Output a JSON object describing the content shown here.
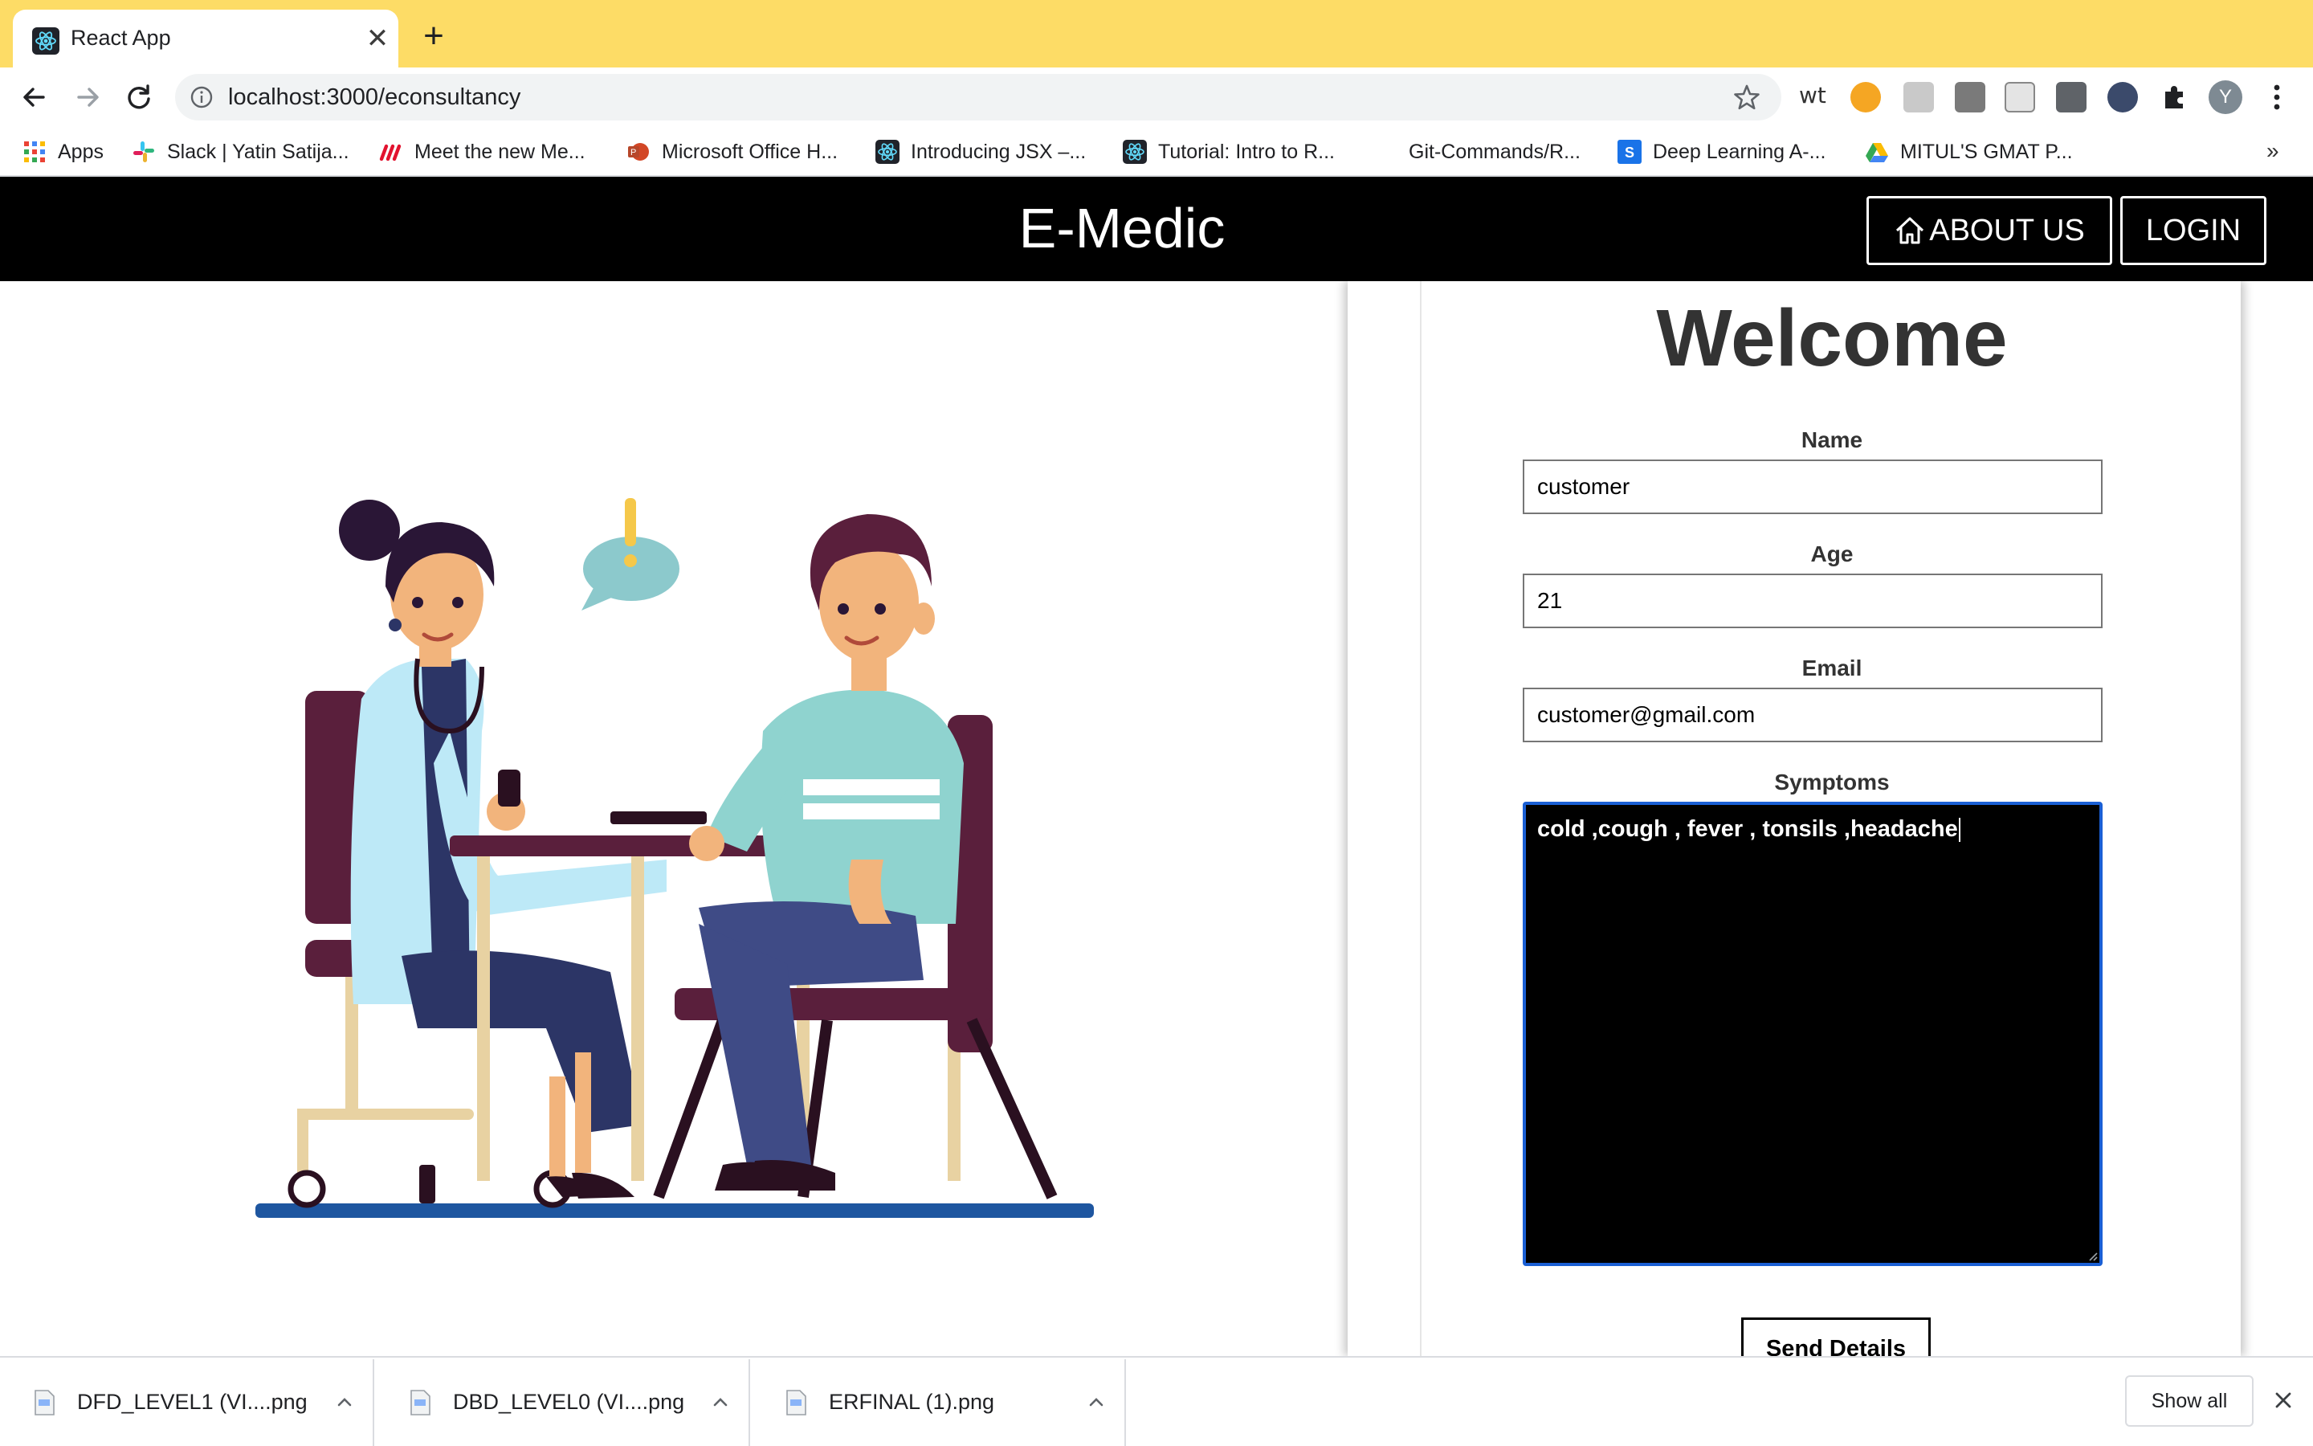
{
  "browser": {
    "tab_title": "React App",
    "new_tab_symbol": "+",
    "close_symbol": "✕",
    "url": "localhost:3000/econsultancy",
    "extension_wt": "wt",
    "profile_initial": "Y",
    "colors": {
      "tabstrip": "#fddc66",
      "omnibox": "#f1f3f4"
    }
  },
  "bookmarks": {
    "items": [
      {
        "label": "Apps",
        "icon": "apps-grid-icon"
      },
      {
        "label": "Slack | Yatin Satija...",
        "icon": "slack-icon"
      },
      {
        "label": "Meet the new Me...",
        "icon": "monday-icon"
      },
      {
        "label": "Microsoft Office H...",
        "icon": "office-icon"
      },
      {
        "label": "Introducing JSX –...",
        "icon": "react-icon"
      },
      {
        "label": "Tutorial: Intro to R...",
        "icon": "react-icon"
      },
      {
        "label": "Git-Commands/R...",
        "icon": "none"
      },
      {
        "label": "Deep Learning A-...",
        "icon": "s-icon"
      },
      {
        "label": "MITUL'S GMAT P...",
        "icon": "drive-icon"
      }
    ],
    "more_symbol": "»"
  },
  "app": {
    "brand": "E-Medic",
    "about_button": "ABOUT US",
    "login_button": "LOGIN",
    "header_color": "#000000"
  },
  "form": {
    "welcome": "Welcome",
    "name_label": "Name",
    "name_value": "customer",
    "age_label": "Age",
    "age_value": "21",
    "email_label": "Email",
    "email_value": "customer@gmail.com",
    "symptoms_label": "Symptoms",
    "symptoms_value": "cold ,cough , fever , tonsils ,headache",
    "send_button": "Send Details",
    "focus_color": "#1a5fd4"
  },
  "downloads": {
    "items": [
      {
        "name": "DFD_LEVEL1 (VI....png"
      },
      {
        "name": "DBD_LEVEL0 (VI....png"
      },
      {
        "name": "ERFINAL (1).png"
      }
    ],
    "show_all": "Show all"
  }
}
